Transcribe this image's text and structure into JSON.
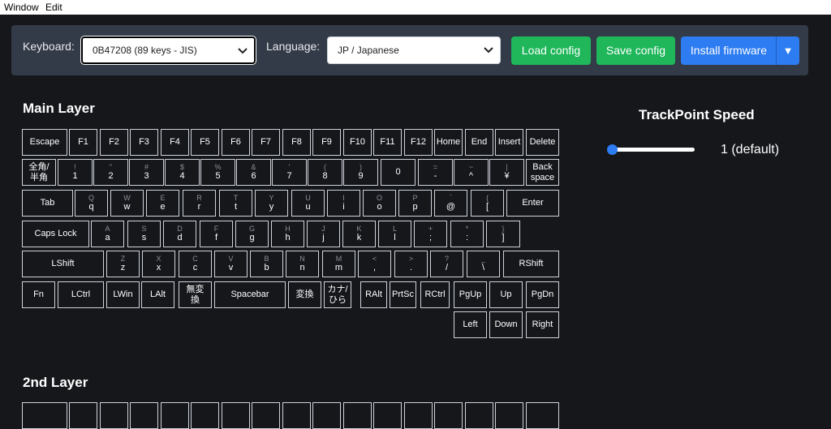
{
  "menu": {
    "window": "Window",
    "edit": "Edit"
  },
  "toolbar": {
    "keyboard_label": "Keyboard:",
    "keyboard_value": "0B47208 (89 keys - JIS)",
    "language_label": "Language:",
    "language_value": "JP / Japanese",
    "load_config": "Load config",
    "save_config": "Save config",
    "install_firmware": "Install firmware",
    "install_dropdown": "▼"
  },
  "main_layer": {
    "title": "Main Layer",
    "rows": [
      [
        {
          "l": "Escape"
        },
        {
          "l": "F1"
        },
        {
          "l": "F2"
        },
        {
          "l": "F3"
        },
        {
          "l": "F4"
        },
        {
          "l": "F5"
        },
        {
          "l": "F6"
        },
        {
          "l": "F7"
        },
        {
          "l": "F8"
        },
        {
          "l": "F9"
        },
        {
          "l": "F10"
        },
        {
          "l": "F11"
        },
        {
          "l": "F12"
        },
        {
          "l": "Home"
        },
        {
          "l": "End"
        },
        {
          "l": "Insert"
        },
        {
          "l": "Delete"
        }
      ],
      [
        {
          "l": "全角/",
          "l2": "半角"
        },
        {
          "s": "!",
          "l": "1"
        },
        {
          "s": "\"",
          "l": "2"
        },
        {
          "s": "#",
          "l": "3"
        },
        {
          "s": "$",
          "l": "4"
        },
        {
          "s": "%",
          "l": "5"
        },
        {
          "s": "&",
          "l": "6"
        },
        {
          "s": "'",
          "l": "7"
        },
        {
          "s": "(",
          "l": "8"
        },
        {
          "s": ")",
          "l": "9"
        },
        {
          "l": "0"
        },
        {
          "s": "=",
          "l": "-"
        },
        {
          "s": "~",
          "l": "^"
        },
        {
          "s": "|",
          "l": "¥"
        },
        {
          "l": "Back",
          "l2": "space"
        }
      ],
      [
        {
          "l": "Tab"
        },
        {
          "s": "Q",
          "l": "q"
        },
        {
          "s": "W",
          "l": "w"
        },
        {
          "s": "E",
          "l": "e"
        },
        {
          "s": "R",
          "l": "r"
        },
        {
          "s": "T",
          "l": "t"
        },
        {
          "s": "Y",
          "l": "y"
        },
        {
          "s": "U",
          "l": "u"
        },
        {
          "s": "I",
          "l": "i"
        },
        {
          "s": "O",
          "l": "o"
        },
        {
          "s": "P",
          "l": "p"
        },
        {
          "s": "`",
          "l": "@"
        },
        {
          "s": "{",
          "l": "["
        },
        {
          "l": "Enter"
        }
      ],
      [
        {
          "l": "Caps Lock"
        },
        {
          "s": "A",
          "l": "a"
        },
        {
          "s": "S",
          "l": "s"
        },
        {
          "s": "D",
          "l": "d"
        },
        {
          "s": "F",
          "l": "f"
        },
        {
          "s": "G",
          "l": "g"
        },
        {
          "s": "H",
          "l": "h"
        },
        {
          "s": "J",
          "l": "j"
        },
        {
          "s": "K",
          "l": "k"
        },
        {
          "s": "L",
          "l": "l"
        },
        {
          "s": "+",
          "l": ";"
        },
        {
          "s": "*",
          "l": ":"
        },
        {
          "s": "}",
          "l": "]"
        }
      ],
      [
        {
          "l": "LShift"
        },
        {
          "s": "Z",
          "l": "z"
        },
        {
          "s": "X",
          "l": "x"
        },
        {
          "s": "C",
          "l": "c"
        },
        {
          "s": "V",
          "l": "v"
        },
        {
          "s": "B",
          "l": "b"
        },
        {
          "s": "N",
          "l": "n"
        },
        {
          "s": "M",
          "l": "m"
        },
        {
          "s": "<",
          "l": ","
        },
        {
          "s": ">",
          "l": "."
        },
        {
          "s": "?",
          "l": "/"
        },
        {
          "s": "_",
          "l": "\\"
        },
        {
          "l": "RShift"
        }
      ],
      [
        {
          "l": "Fn"
        },
        {
          "l": "LCtrl"
        },
        {
          "l": "LWin"
        },
        {
          "l": "LAlt"
        },
        {
          "l": "無変",
          "l2": "換"
        },
        {
          "l": "Spacebar"
        },
        {
          "l": "変換"
        },
        {
          "l": "カナ/",
          "l2": "ひら"
        },
        {
          "l": "RAlt"
        },
        {
          "l": "PrtSc"
        },
        {
          "l": "RCtrl"
        },
        {
          "l": "PgUp"
        },
        {
          "l": "Up"
        },
        {
          "l": "PgDn"
        }
      ],
      [
        {
          "l": "Left"
        },
        {
          "l": "Down"
        },
        {
          "l": "Right"
        }
      ]
    ]
  },
  "second_layer": {
    "title": "2nd Layer"
  },
  "trackpoint": {
    "title": "TrackPoint Speed",
    "value_text": "1 (default)",
    "slider_fraction": 0.0
  }
}
